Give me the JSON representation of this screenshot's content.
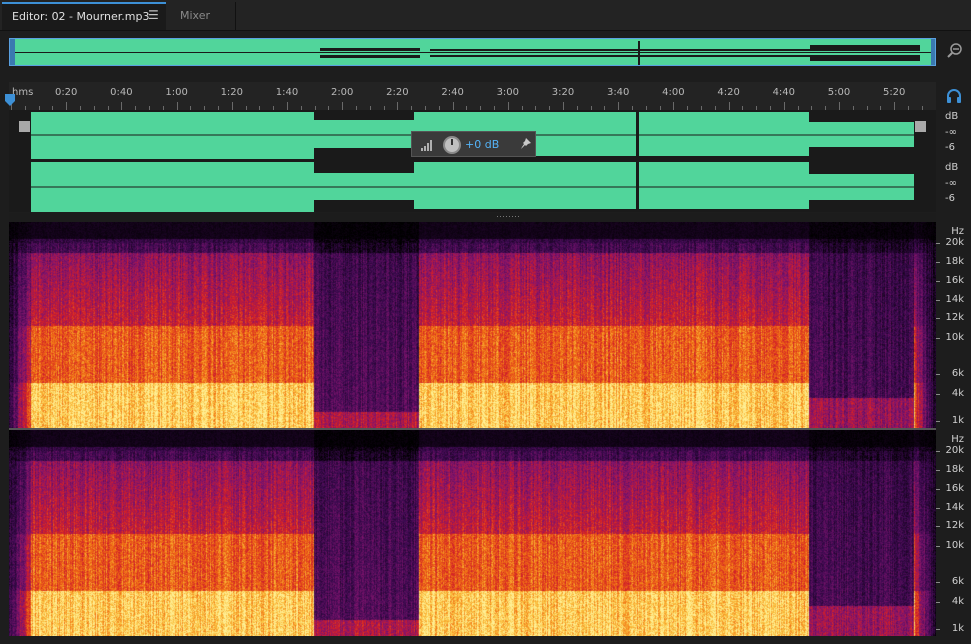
{
  "tabs": {
    "editor_label": "Editor: 02 - Mourner.mp3",
    "menu_glyph": "☰",
    "mixer_label": "Mixer"
  },
  "ruler": {
    "unit": "hms",
    "ticks": [
      "0:20",
      "0:40",
      "1:00",
      "1:20",
      "1:40",
      "2:00",
      "2:20",
      "2:40",
      "3:00",
      "3:20",
      "3:40",
      "4:00",
      "4:20",
      "4:40",
      "5:00",
      "5:20"
    ]
  },
  "hud": {
    "gain": "+0 dB"
  },
  "waveform_scale": {
    "top": [
      "dB",
      "-∞",
      "-6"
    ],
    "bottom": [
      "dB",
      "-∞",
      "-6"
    ]
  },
  "spectral_scale": {
    "unit": "Hz",
    "labels": [
      "20k",
      "18k",
      "16k",
      "14k",
      "12k",
      "10k",
      "6k",
      "4k",
      "1k"
    ]
  },
  "colors": {
    "waveform": "#51d59b",
    "accent": "#54b3f7",
    "selection": "#5aa0e0"
  },
  "icons": {
    "zoom": "zoom-out-icon",
    "headphones": "headphones-icon",
    "playhead": "playhead-icon",
    "hud_meter": "level-meter-icon",
    "hud_knob": "gain-knob-icon",
    "hud_pin": "pin-icon"
  }
}
